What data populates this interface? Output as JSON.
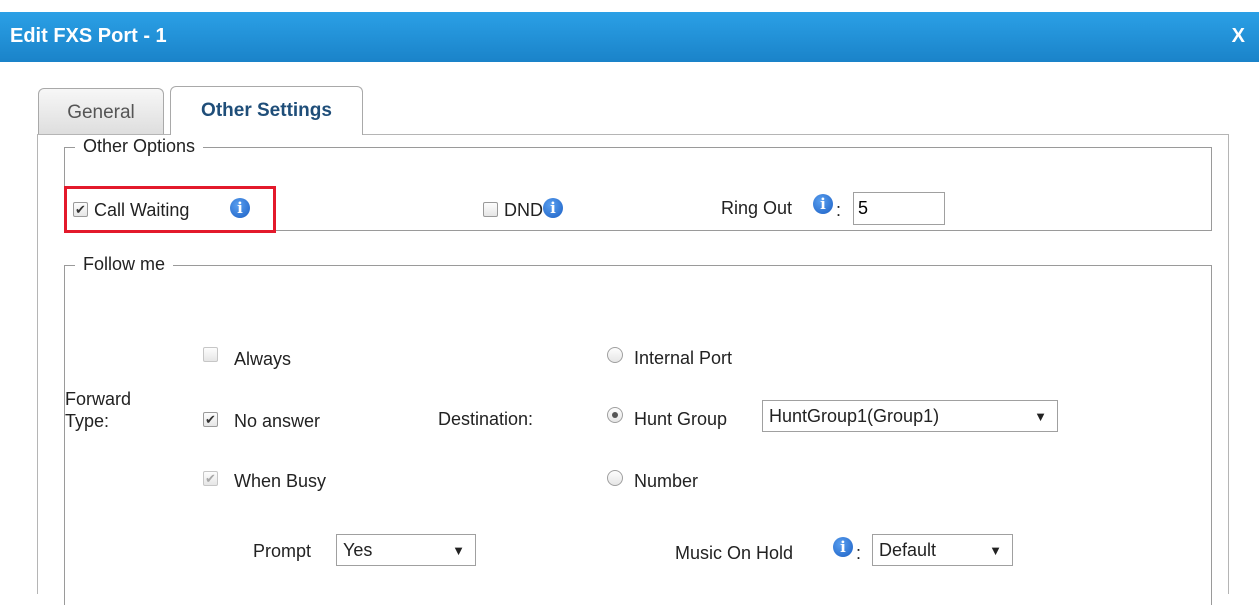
{
  "dialog": {
    "title": "Edit FXS Port - 1",
    "close_label": "X"
  },
  "tabs": [
    {
      "label": "General",
      "active": false
    },
    {
      "label": "Other Settings",
      "active": true
    }
  ],
  "other_options": {
    "legend": "Other Options",
    "call_waiting": {
      "label": "Call Waiting",
      "checked": true
    },
    "dnd": {
      "label": "DND",
      "checked": false
    },
    "ring_out": {
      "label": "Ring Out",
      "sep": ":",
      "value": "5"
    }
  },
  "follow_me": {
    "legend": "Follow me",
    "forward_type_label": "Forward Type:",
    "forward_types": [
      {
        "label": "Always",
        "checked": false
      },
      {
        "label": "No answer",
        "checked": true
      },
      {
        "label": "When Busy",
        "checked": true,
        "disabled": true
      }
    ],
    "destination_label": "Destination:",
    "destinations": [
      {
        "label": "Internal Port",
        "selected": false
      },
      {
        "label": "Hunt Group",
        "selected": true
      },
      {
        "label": "Number",
        "selected": false
      }
    ],
    "hunt_group_value": "HuntGroup1(Group1)",
    "prompt_label": "Prompt",
    "prompt_value": "Yes",
    "music_on_hold_label": "Music On Hold",
    "music_on_hold_sep": ":",
    "music_on_hold_value": "Default"
  },
  "colors": {
    "titlebar": "#1f8fd8",
    "highlight": "#e3192b",
    "active_tab_text": "#1f4e79"
  }
}
